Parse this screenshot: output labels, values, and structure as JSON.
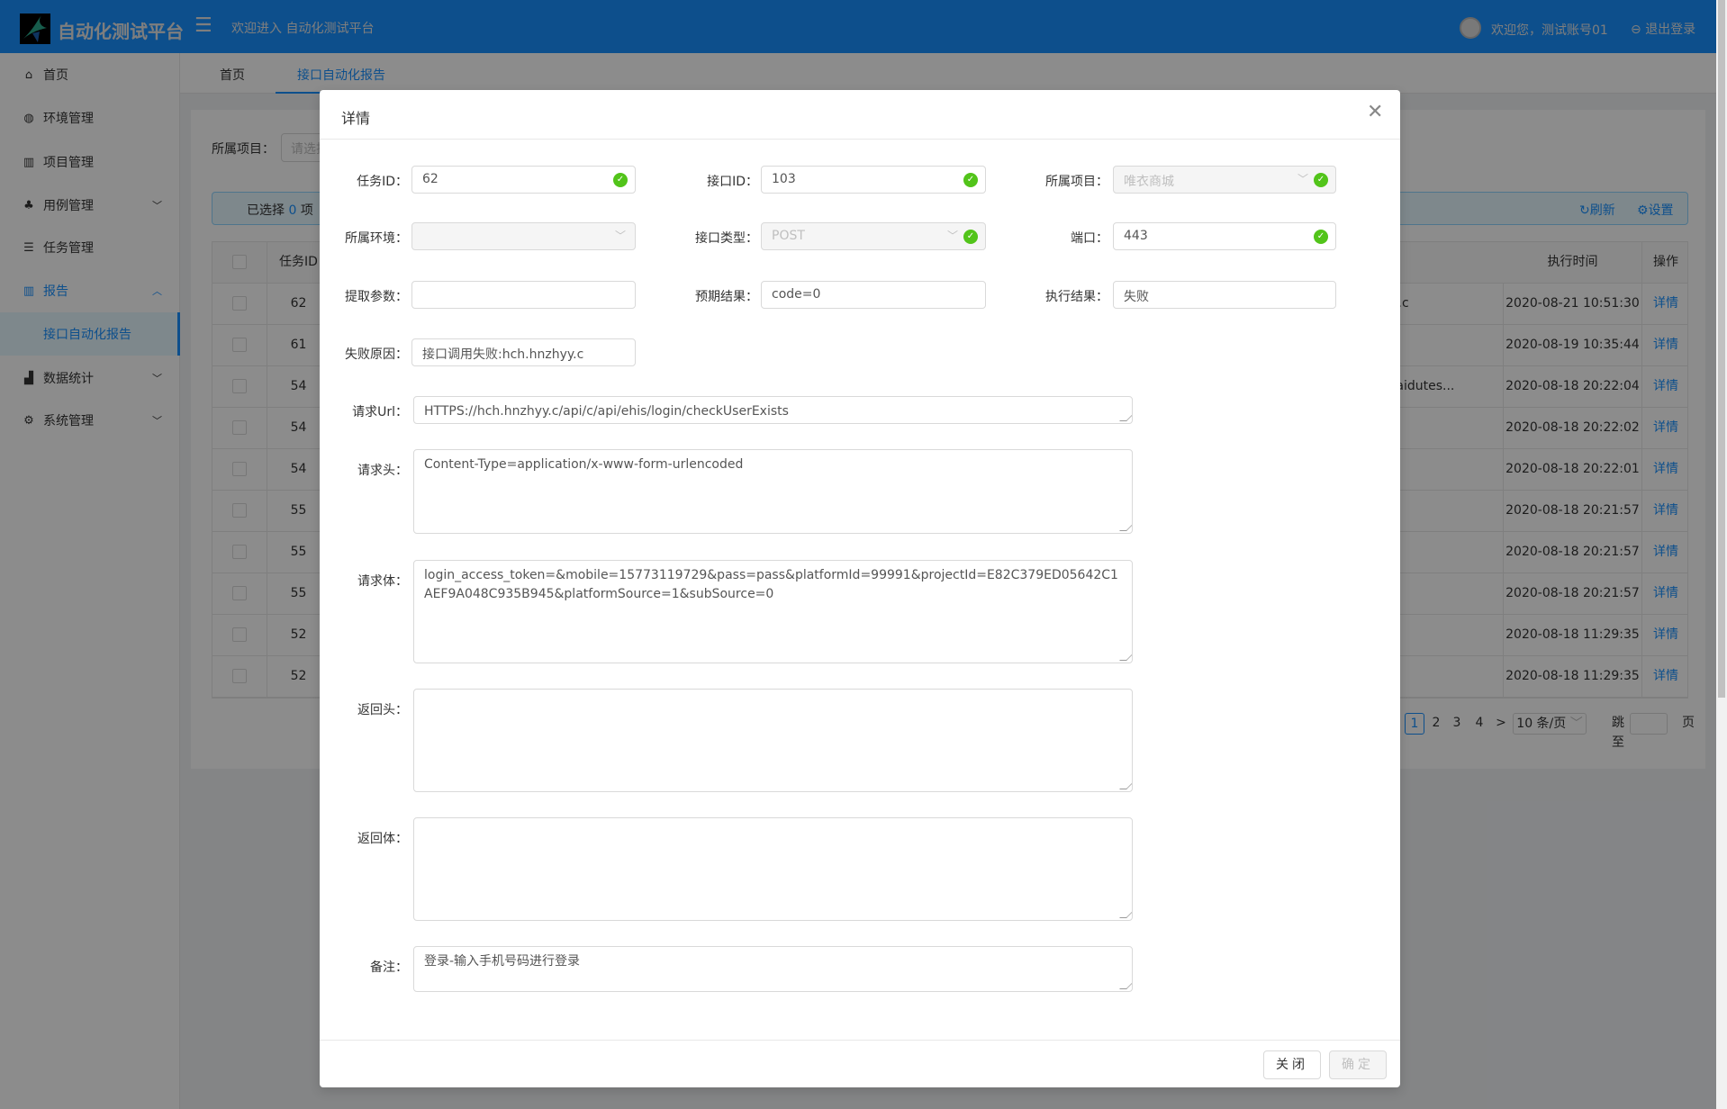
{
  "header": {
    "app_title": "自动化测试平台",
    "welcome": "欢迎进入 自动化测试平台",
    "user_greeting": "欢迎您，测试账号01",
    "logout": "退出登录"
  },
  "sidebar": {
    "items": [
      {
        "label": "首页",
        "icon": "home-icon"
      },
      {
        "label": "环境管理",
        "icon": "globe-icon"
      },
      {
        "label": "项目管理",
        "icon": "project-icon"
      },
      {
        "label": "用例管理",
        "icon": "cluster-icon"
      },
      {
        "label": "任务管理",
        "icon": "list-icon"
      },
      {
        "label": "报告",
        "icon": "report-icon"
      },
      {
        "label": "接口自动化报告"
      },
      {
        "label": "数据统计",
        "icon": "chart-icon"
      },
      {
        "label": "系统管理",
        "icon": "gear-icon"
      }
    ]
  },
  "tabs": [
    {
      "label": "首页"
    },
    {
      "label": "接口自动化报告",
      "active": true
    }
  ],
  "filter": {
    "label": "所属项目：",
    "placeholder": "请选择"
  },
  "alert": {
    "prefix": "已选择",
    "count": "0",
    "suffix": "项",
    "refresh": "刷新",
    "settings": "设置"
  },
  "table": {
    "headers": {
      "task_id": "任务ID",
      "exec_time": "执行时间",
      "action": "操作"
    },
    "rows": [
      {
        "task_id": "62",
        "partial": "hnzhyy.c",
        "exec_time": "2020-08-21 10:51:30",
        "action": "详情"
      },
      {
        "task_id": "61",
        "partial": "",
        "exec_time": "2020-08-19 10:35:44",
        "action": "详情"
      },
      {
        "task_id": "54",
        "partial": "www.baidutes...",
        "exec_time": "2020-08-18 20:22:04",
        "action": "详情"
      },
      {
        "task_id": "54",
        "partial": "",
        "exec_time": "2020-08-18 20:22:02",
        "action": "详情"
      },
      {
        "task_id": "54",
        "partial": "",
        "exec_time": "2020-08-18 20:22:01",
        "action": "详情"
      },
      {
        "task_id": "55",
        "partial": "",
        "exec_time": "2020-08-18 20:21:57",
        "action": "详情"
      },
      {
        "task_id": "55",
        "partial": "",
        "exec_time": "2020-08-18 20:21:57",
        "action": "详情"
      },
      {
        "task_id": "55",
        "partial": "",
        "exec_time": "2020-08-18 20:21:57",
        "action": "详情"
      },
      {
        "task_id": "52",
        "partial": "",
        "exec_time": "2020-08-18 11:29:35",
        "action": "详情"
      },
      {
        "task_id": "52",
        "partial": "",
        "exec_time": "2020-08-18 11:29:35",
        "action": "详情"
      }
    ]
  },
  "pagination": {
    "pages": [
      "1",
      "2",
      "3",
      "4"
    ],
    "current": "1",
    "next": ">",
    "page_size": "10 条/页",
    "jump_label": "跳至",
    "page_suffix": "页"
  },
  "dialog": {
    "title": "详情",
    "fields": {
      "task_id": {
        "label": "任务ID：",
        "value": "62"
      },
      "api_id": {
        "label": "接口ID：",
        "value": "103"
      },
      "project": {
        "label": "所属项目：",
        "value": "唯衣商城"
      },
      "env": {
        "label": "所属环境：",
        "value": ""
      },
      "api_type": {
        "label": "接口类型：",
        "value": "POST"
      },
      "port": {
        "label": "端口：",
        "value": "443"
      },
      "extract": {
        "label": "提取参数：",
        "value": ""
      },
      "expected": {
        "label": "预期结果：",
        "value": "code=0"
      },
      "result": {
        "label": "执行结果：",
        "value": "失败"
      },
      "fail_reason": {
        "label": "失败原因：",
        "value": "接口调用失败:hch.hnzhyy.c"
      },
      "url": {
        "label": "请求Url：",
        "value": "HTTPS://hch.hnzhyy.c/api/c/api/ehis/login/checkUserExists"
      },
      "req_header": {
        "label": "请求头：",
        "value": "Content-Type=application/x-www-form-urlencoded"
      },
      "req_body": {
        "label": "请求体：",
        "value": "login_access_token=&mobile=15773119729&pass=pass&platformId=99991&projectId=E82C379ED05642C1AEF9A048C935B945&platformSource=1&subSource=0"
      },
      "resp_header": {
        "label": "返回头：",
        "value": ""
      },
      "resp_body": {
        "label": "返回体：",
        "value": ""
      },
      "remark": {
        "label": "备注：",
        "value": "登录-输入手机号码进行登录"
      }
    },
    "close_button": "关闭",
    "ok_button": "确定"
  },
  "colors": {
    "primary": "#1890ff",
    "success": "#52c41a"
  }
}
